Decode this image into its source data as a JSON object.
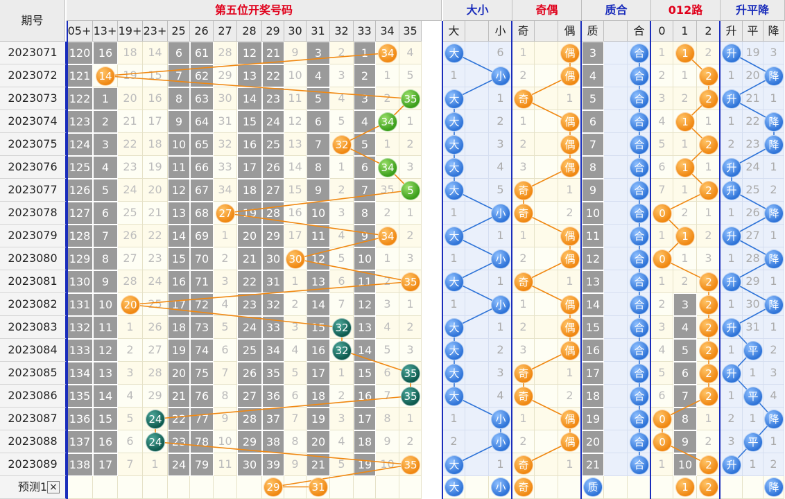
{
  "header": {
    "period_label": "期号",
    "groups": [
      {
        "label": "第五位开奖号码",
        "color": "red"
      },
      {
        "label": "大小",
        "color": "blue"
      },
      {
        "label": "奇偶",
        "color": "red"
      },
      {
        "label": "质合",
        "color": "blue"
      },
      {
        "label": "012路",
        "color": "red"
      },
      {
        "label": "升平降",
        "color": "blue"
      }
    ],
    "number_columns": [
      "05+",
      "13+",
      "19+",
      "23+",
      "25",
      "26",
      "27",
      "28",
      "29",
      "30",
      "31",
      "32",
      "33",
      "34",
      "35"
    ],
    "size_columns": [
      "大",
      "",
      "小"
    ],
    "parity_columns": [
      "奇",
      "",
      "偶"
    ],
    "prime_columns": [
      "质",
      "",
      "合"
    ],
    "mod_columns": [
      "0",
      "1",
      "2"
    ],
    "trend_columns": [
      "升",
      "平",
      "降"
    ]
  },
  "rows": [
    {
      "period": "2023071",
      "nums": [
        "120",
        "16",
        "18",
        "14",
        "6",
        "61",
        "28",
        "12",
        "21",
        "9",
        "3",
        "2",
        "1",
        "34",
        "4"
      ],
      "size": [
        "大",
        "",
        "6"
      ],
      "parity": [
        "1",
        "",
        "偶"
      ],
      "prime": [
        "3",
        "",
        "合"
      ],
      "mod": [
        "1",
        "1",
        "2"
      ],
      "trend": [
        "升",
        "19",
        "3"
      ]
    },
    {
      "period": "2023072",
      "nums": [
        "121",
        "14",
        "19",
        "15",
        "7",
        "62",
        "29",
        "13",
        "22",
        "10",
        "4",
        "3",
        "2",
        "1",
        "5"
      ],
      "size": [
        "1",
        "",
        "小"
      ],
      "parity": [
        "2",
        "",
        "偶"
      ],
      "prime": [
        "4",
        "",
        "合"
      ],
      "mod": [
        "2",
        "1",
        "2"
      ],
      "trend": [
        "1",
        "20",
        "降"
      ]
    },
    {
      "period": "2023073",
      "nums": [
        "122",
        "1",
        "20",
        "16",
        "8",
        "63",
        "30",
        "14",
        "23",
        "11",
        "5",
        "4",
        "3",
        "2",
        "35"
      ],
      "size": [
        "大",
        "",
        "1"
      ],
      "parity": [
        "奇",
        "",
        "1"
      ],
      "prime": [
        "5",
        "",
        "合"
      ],
      "mod": [
        "3",
        "2",
        "2"
      ],
      "trend": [
        "升",
        "21",
        "1"
      ]
    },
    {
      "period": "2023074",
      "nums": [
        "123",
        "2",
        "21",
        "17",
        "9",
        "64",
        "31",
        "15",
        "24",
        "12",
        "6",
        "5",
        "4",
        "34",
        "1"
      ],
      "size": [
        "大",
        "",
        "2"
      ],
      "parity": [
        "1",
        "",
        "偶"
      ],
      "prime": [
        "6",
        "",
        "合"
      ],
      "mod": [
        "4",
        "1",
        "1"
      ],
      "trend": [
        "1",
        "22",
        "降"
      ]
    },
    {
      "period": "2023075",
      "nums": [
        "124",
        "3",
        "22",
        "18",
        "10",
        "65",
        "32",
        "16",
        "25",
        "13",
        "7",
        "32",
        "5",
        "1",
        "2"
      ],
      "size": [
        "大",
        "",
        "3"
      ],
      "parity": [
        "2",
        "",
        "偶"
      ],
      "prime": [
        "7",
        "",
        "合"
      ],
      "mod": [
        "5",
        "1",
        "2"
      ],
      "trend": [
        "2",
        "23",
        "降"
      ]
    },
    {
      "period": "2023076",
      "nums": [
        "125",
        "4",
        "23",
        "19",
        "11",
        "66",
        "33",
        "17",
        "26",
        "14",
        "8",
        "1",
        "6",
        "34",
        "3"
      ],
      "size": [
        "大",
        "",
        "4"
      ],
      "parity": [
        "3",
        "",
        "偶"
      ],
      "prime": [
        "8",
        "",
        "合"
      ],
      "mod": [
        "6",
        "1",
        "1"
      ],
      "trend": [
        "升",
        "24",
        "1"
      ]
    },
    {
      "period": "2023077",
      "nums": [
        "126",
        "5",
        "24",
        "20",
        "12",
        "67",
        "34",
        "18",
        "27",
        "15",
        "9",
        "2",
        "7",
        "35",
        "5"
      ],
      "size": [
        "大",
        "",
        "5"
      ],
      "parity": [
        "奇",
        "",
        "1"
      ],
      "prime": [
        "9",
        "",
        "合"
      ],
      "mod": [
        "7",
        "1",
        "2"
      ],
      "trend": [
        "升",
        "25",
        "2"
      ]
    },
    {
      "period": "2023078",
      "nums": [
        "127",
        "6",
        "25",
        "21",
        "13",
        "68",
        "27",
        "19",
        "28",
        "16",
        "10",
        "3",
        "8",
        "2",
        "1"
      ],
      "size": [
        "1",
        "",
        "小"
      ],
      "parity": [
        "奇",
        "",
        "2"
      ],
      "prime": [
        "10",
        "",
        "合"
      ],
      "mod": [
        "0",
        "2",
        "1"
      ],
      "trend": [
        "1",
        "26",
        "降"
      ]
    },
    {
      "period": "2023079",
      "nums": [
        "128",
        "7",
        "26",
        "22",
        "14",
        "69",
        "1",
        "20",
        "29",
        "17",
        "11",
        "4",
        "9",
        "34",
        "2"
      ],
      "size": [
        "大",
        "",
        "1"
      ],
      "parity": [
        "1",
        "",
        "偶"
      ],
      "prime": [
        "11",
        "",
        "合"
      ],
      "mod": [
        "1",
        "1",
        "2"
      ],
      "trend": [
        "升",
        "27",
        "1"
      ]
    },
    {
      "period": "2023080",
      "nums": [
        "129",
        "8",
        "27",
        "23",
        "15",
        "70",
        "2",
        "21",
        "30",
        "30",
        "12",
        "5",
        "10",
        "1",
        "3"
      ],
      "size": [
        "1",
        "",
        "小"
      ],
      "parity": [
        "2",
        "",
        "偶"
      ],
      "prime": [
        "12",
        "",
        "合"
      ],
      "mod": [
        "0",
        "1",
        "3"
      ],
      "trend": [
        "1",
        "28",
        "降"
      ]
    },
    {
      "period": "2023081",
      "nums": [
        "130",
        "9",
        "28",
        "24",
        "16",
        "71",
        "3",
        "22",
        "31",
        "1",
        "13",
        "6",
        "11",
        "2",
        "35"
      ],
      "size": [
        "大",
        "",
        "1"
      ],
      "parity": [
        "奇",
        "",
        "1"
      ],
      "prime": [
        "13",
        "",
        "合"
      ],
      "mod": [
        "1",
        "2",
        "2"
      ],
      "trend": [
        "升",
        "29",
        "1"
      ]
    },
    {
      "period": "2023082",
      "nums": [
        "131",
        "10",
        "20",
        "25",
        "17",
        "72",
        "4",
        "23",
        "32",
        "2",
        "14",
        "7",
        "12",
        "3",
        "1"
      ],
      "size": [
        "1",
        "",
        "小"
      ],
      "parity": [
        "1",
        "",
        "偶"
      ],
      "prime": [
        "14",
        "",
        "合"
      ],
      "mod": [
        "2",
        "3",
        "2"
      ],
      "trend": [
        "1",
        "30",
        "降"
      ]
    },
    {
      "period": "2023083",
      "nums": [
        "132",
        "11",
        "1",
        "26",
        "18",
        "73",
        "5",
        "24",
        "33",
        "3",
        "15",
        "32",
        "13",
        "4",
        "2"
      ],
      "size": [
        "大",
        "",
        "1"
      ],
      "parity": [
        "2",
        "",
        "偶"
      ],
      "prime": [
        "15",
        "",
        "合"
      ],
      "mod": [
        "3",
        "4",
        "2"
      ],
      "trend": [
        "升",
        "31",
        "1"
      ]
    },
    {
      "period": "2023084",
      "nums": [
        "133",
        "12",
        "2",
        "27",
        "19",
        "74",
        "6",
        "25",
        "34",
        "4",
        "16",
        "32",
        "14",
        "5",
        "3"
      ],
      "size": [
        "大",
        "",
        "2"
      ],
      "parity": [
        "3",
        "",
        "偶"
      ],
      "prime": [
        "16",
        "",
        "合"
      ],
      "mod": [
        "4",
        "5",
        "2"
      ],
      "trend": [
        "1",
        "平",
        "2"
      ]
    },
    {
      "period": "2023085",
      "nums": [
        "134",
        "13",
        "3",
        "28",
        "20",
        "75",
        "7",
        "26",
        "35",
        "5",
        "17",
        "1",
        "15",
        "6",
        "35"
      ],
      "size": [
        "大",
        "",
        "3"
      ],
      "parity": [
        "奇",
        "",
        "1"
      ],
      "prime": [
        "17",
        "",
        "合"
      ],
      "mod": [
        "5",
        "6",
        "2"
      ],
      "trend": [
        "升",
        "1",
        "3"
      ]
    },
    {
      "period": "2023086",
      "nums": [
        "135",
        "14",
        "4",
        "29",
        "21",
        "76",
        "8",
        "27",
        "36",
        "6",
        "18",
        "2",
        "16",
        "7",
        "35"
      ],
      "size": [
        "大",
        "",
        "4"
      ],
      "parity": [
        "奇",
        "",
        "2"
      ],
      "prime": [
        "18",
        "",
        "合"
      ],
      "mod": [
        "6",
        "7",
        "2"
      ],
      "trend": [
        "1",
        "平",
        "4"
      ]
    },
    {
      "period": "2023087",
      "nums": [
        "136",
        "15",
        "5",
        "24",
        "22",
        "77",
        "9",
        "28",
        "37",
        "7",
        "19",
        "3",
        "17",
        "8",
        "1"
      ],
      "size": [
        "1",
        "",
        "小"
      ],
      "parity": [
        "1",
        "",
        "偶"
      ],
      "prime": [
        "19",
        "",
        "合"
      ],
      "mod": [
        "0",
        "8",
        "1"
      ],
      "trend": [
        "2",
        "1",
        "降"
      ]
    },
    {
      "period": "2023088",
      "nums": [
        "137",
        "16",
        "6",
        "24",
        "23",
        "78",
        "10",
        "29",
        "38",
        "8",
        "20",
        "4",
        "18",
        "9",
        "2"
      ],
      "size": [
        "2",
        "",
        "小"
      ],
      "parity": [
        "2",
        "",
        "偶"
      ],
      "prime": [
        "20",
        "",
        "合"
      ],
      "mod": [
        "0",
        "9",
        "2"
      ],
      "trend": [
        "3",
        "平",
        "1"
      ]
    },
    {
      "period": "2023089",
      "nums": [
        "138",
        "17",
        "7",
        "1",
        "24",
        "79",
        "11",
        "30",
        "39",
        "9",
        "21",
        "5",
        "19",
        "10",
        "35"
      ],
      "size": [
        "大",
        "",
        "1"
      ],
      "parity": [
        "奇",
        "",
        "1"
      ],
      "prime": [
        "21",
        "",
        "合"
      ],
      "mod": [
        "1",
        "10",
        "2"
      ],
      "trend": [
        "升",
        "1",
        "2"
      ]
    }
  ],
  "prediction": {
    "label": "预测1",
    "close_symbol": "×",
    "number_balls": [
      "29",
      "31"
    ],
    "size_balls": [
      "大",
      "小"
    ],
    "parity_ball": "奇",
    "prime_ball": "质",
    "mod_balls": [
      "1",
      "2"
    ],
    "trend_ball": "降"
  },
  "colors": {
    "accent_blue": "#1a2dbb",
    "accent_red": "#e0001b",
    "orange": "#f08812",
    "green": "#3b9e1b",
    "teal": "#0d5a4e",
    "gray": "#9a9a9a"
  }
}
